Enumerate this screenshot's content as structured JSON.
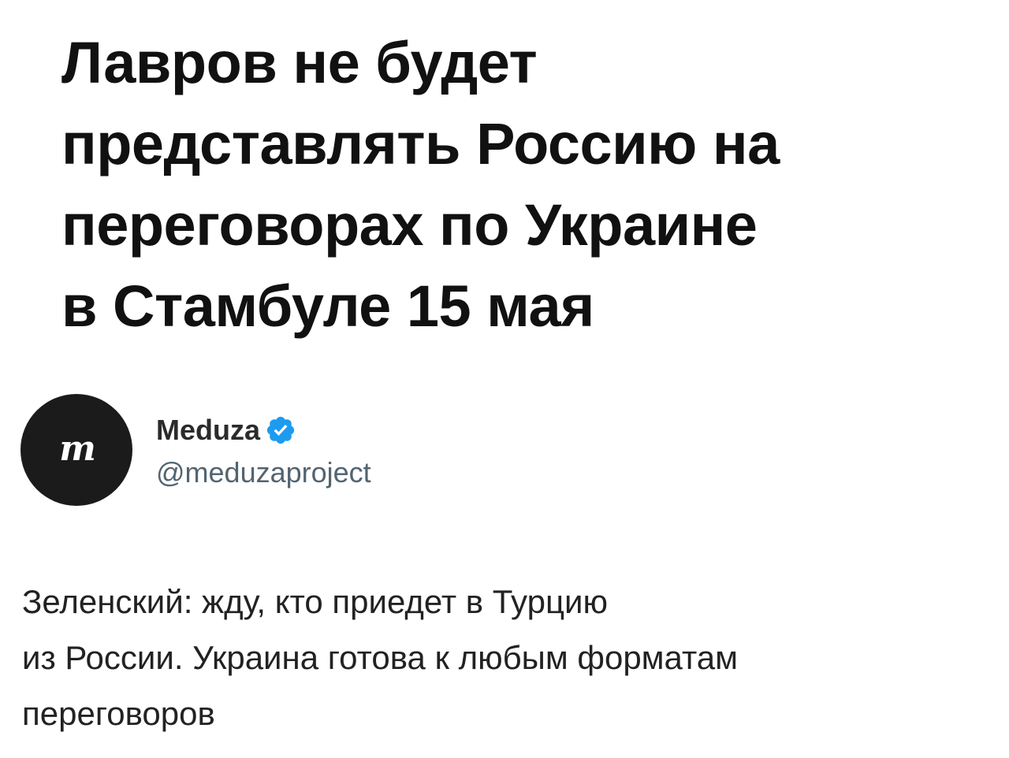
{
  "headline": {
    "lines": [
      "Лавров не будет",
      "представлять Россию на",
      "переговорах по Украине",
      "в Стамбуле 15 мая"
    ]
  },
  "account": {
    "avatar_logo": "m",
    "display_name": "Meduza",
    "verified_icon": "verified-badge-icon",
    "verified_color": "#1d9bf0",
    "handle": "@meduzaproject"
  },
  "tweet": {
    "lines": [
      "Зеленский: жду, кто приедет в Турцию",
      "из России. Украина готова к любым форматам",
      "переговоров"
    ]
  }
}
